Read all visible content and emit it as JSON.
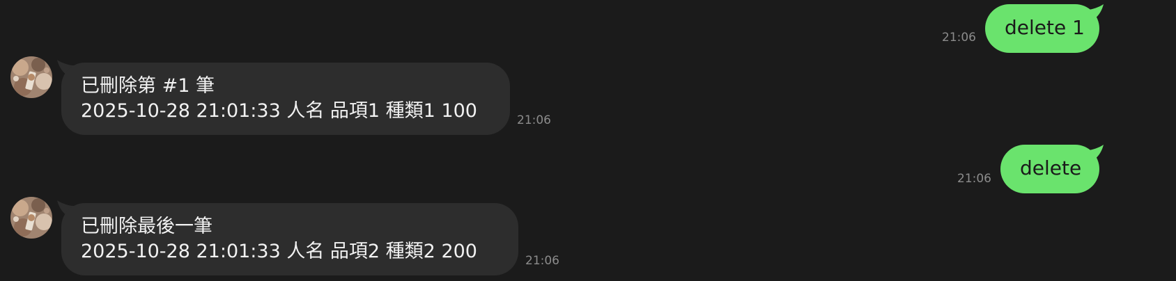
{
  "messages": [
    {
      "direction": "outgoing",
      "text": "delete 1",
      "time": "21:06"
    },
    {
      "direction": "incoming",
      "lines": [
        "已刪除第 #1 筆",
        "2025-10-28 21:01:33 人名 品項1 種類1 100"
      ],
      "time": "21:06",
      "avatar_icon": "user-avatar-photo"
    },
    {
      "direction": "outgoing",
      "text": "delete",
      "time": "21:06"
    },
    {
      "direction": "incoming",
      "lines": [
        "已刪除最後一筆",
        "2025-10-28 21:01:33 人名 品項2 種類2 200"
      ],
      "time": "21:06",
      "avatar_icon": "user-avatar-photo"
    }
  ],
  "colors": {
    "background": "#1b1b1b",
    "outgoing_bubble": "#6ae36d",
    "incoming_bubble": "#2d2d2d",
    "timestamp": "#8c8c8c"
  }
}
